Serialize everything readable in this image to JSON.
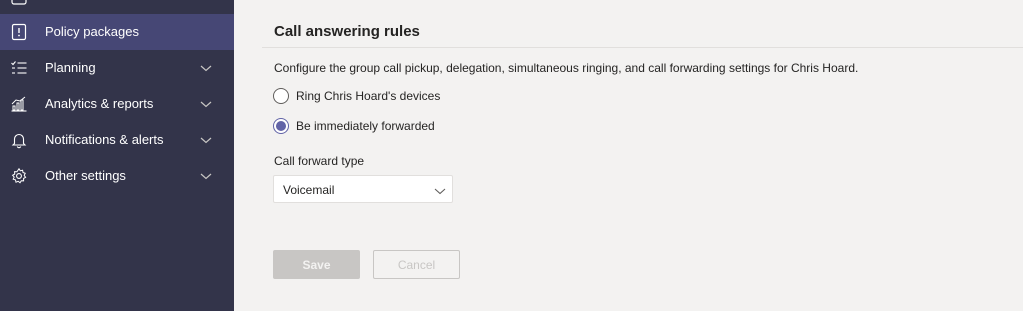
{
  "sidebar": {
    "items": [
      {
        "label": "Policy packages",
        "icon": "policy-package-icon",
        "selected": true,
        "has_chevron": false
      },
      {
        "label": "Planning",
        "icon": "planning-list-icon",
        "selected": false,
        "has_chevron": true
      },
      {
        "label": "Analytics & reports",
        "icon": "analytics-chart-icon",
        "selected": false,
        "has_chevron": true
      },
      {
        "label": "Notifications & alerts",
        "icon": "bell-icon",
        "selected": false,
        "has_chevron": true
      },
      {
        "label": "Other settings",
        "icon": "gear-icon",
        "selected": false,
        "has_chevron": true
      }
    ]
  },
  "main": {
    "title": "Call answering rules",
    "description": "Configure the group call pickup, delegation, simultaneous ringing, and call forwarding settings for Chris Hoard.",
    "options": [
      {
        "label": "Ring Chris Hoard's devices",
        "checked": false
      },
      {
        "label": "Be immediately forwarded",
        "checked": true
      }
    ],
    "forward_type": {
      "label": "Call forward type",
      "value": "Voicemail"
    },
    "buttons": {
      "save": "Save",
      "cancel": "Cancel"
    }
  },
  "colors": {
    "sidebar_bg": "#33344a",
    "sidebar_selected": "#464775",
    "accent": "#6264a7",
    "page_bg": "#f3f2f1"
  }
}
